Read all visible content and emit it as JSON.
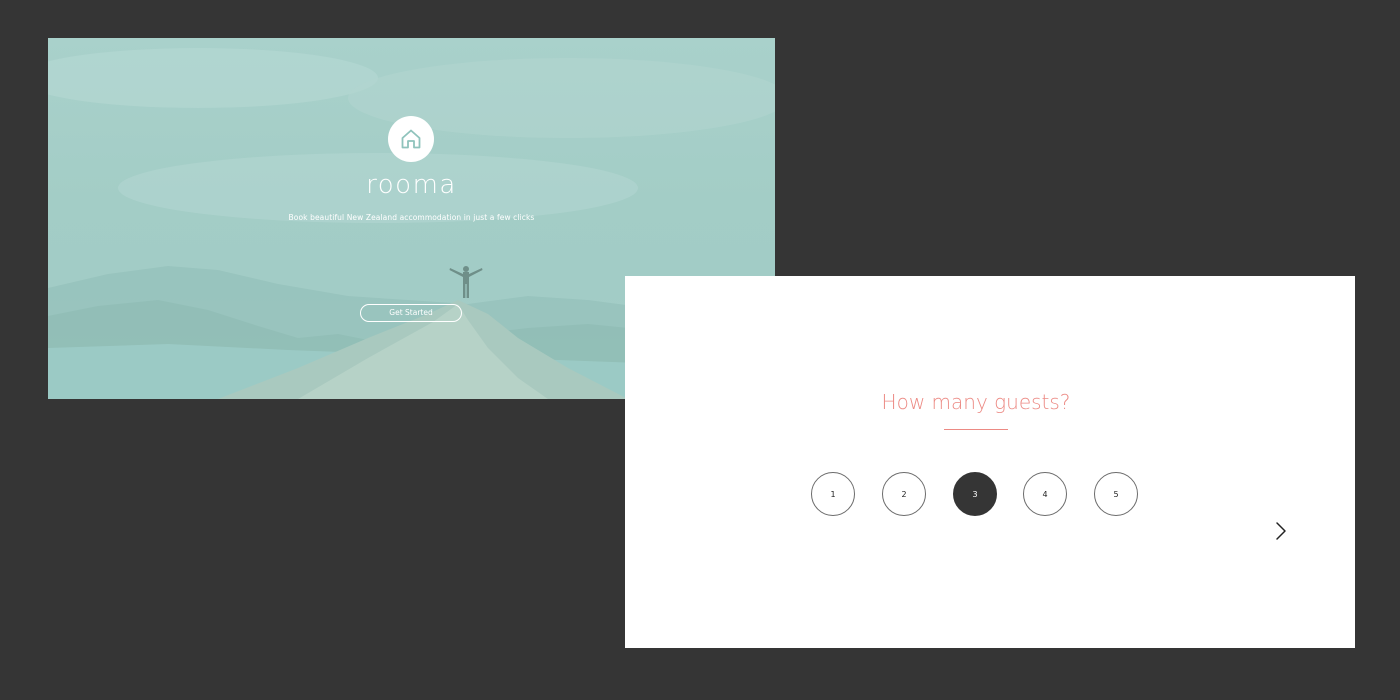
{
  "hero": {
    "logo_icon": "house-icon",
    "brand": "rooma",
    "tagline": "Book beautiful New Zealand accommodation in just a few clicks",
    "cta_label": "Get Started"
  },
  "guests": {
    "question": "How many guests?",
    "options": [
      "1",
      "2",
      "3",
      "4",
      "5"
    ],
    "selected": "3",
    "next_icon": "chevron-right-icon"
  },
  "colors": {
    "background": "#353535",
    "hero_tint": "#a6cfc9",
    "accent": "#ec8a84",
    "selected_fill": "#353535"
  }
}
